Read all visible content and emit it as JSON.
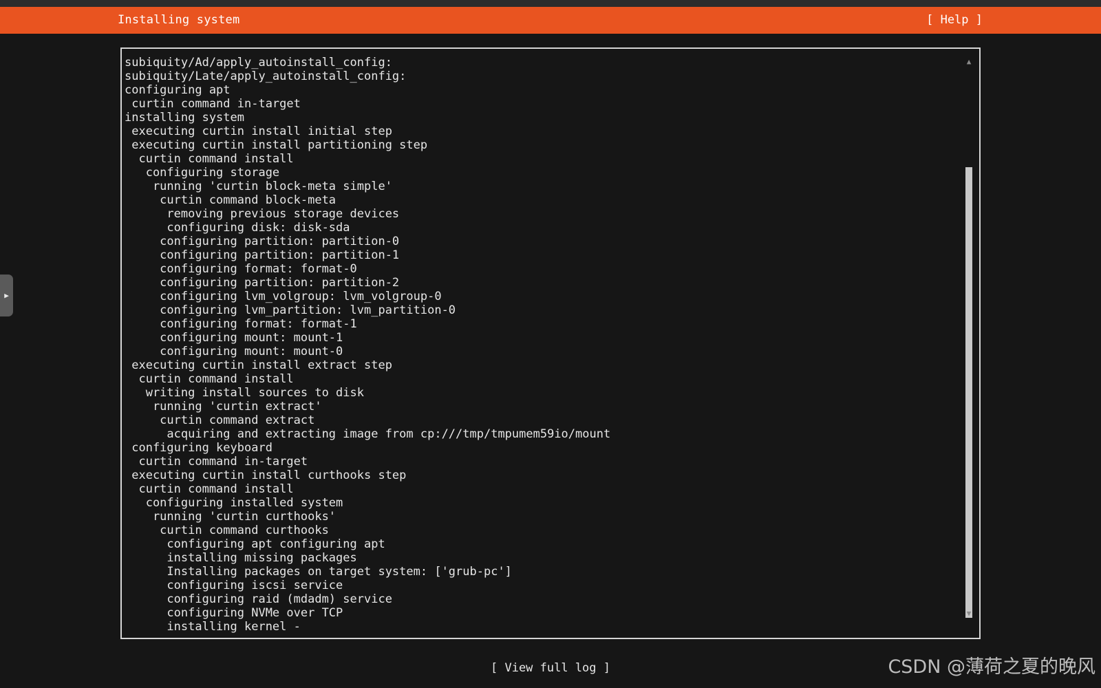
{
  "header": {
    "title": "Installing system",
    "help_label": "[ Help ]",
    "accent_color": "#e95420"
  },
  "log": {
    "lines": [
      "subiquity/Ad/apply_autoinstall_config:",
      "subiquity/Late/apply_autoinstall_config:",
      "configuring apt",
      " curtin command in-target",
      "installing system",
      " executing curtin install initial step",
      " executing curtin install partitioning step",
      "  curtin command install",
      "   configuring storage",
      "    running 'curtin block-meta simple'",
      "     curtin command block-meta",
      "      removing previous storage devices",
      "      configuring disk: disk-sda",
      "     configuring partition: partition-0",
      "     configuring partition: partition-1",
      "     configuring format: format-0",
      "     configuring partition: partition-2",
      "     configuring lvm_volgroup: lvm_volgroup-0",
      "     configuring lvm_partition: lvm_partition-0",
      "     configuring format: format-1",
      "     configuring mount: mount-1",
      "     configuring mount: mount-0",
      " executing curtin install extract step",
      "  curtin command install",
      "   writing install sources to disk",
      "    running 'curtin extract'",
      "     curtin command extract",
      "      acquiring and extracting image from cp:///tmp/tmpumem59io/mount",
      " configuring keyboard",
      "  curtin command in-target",
      " executing curtin install curthooks step",
      "  curtin command install",
      "   configuring installed system",
      "    running 'curtin curthooks'",
      "     curtin command curthooks",
      "      configuring apt configuring apt",
      "      installing missing packages",
      "      Installing packages on target system: ['grub-pc']",
      "      configuring iscsi service",
      "      configuring raid (mdadm) service",
      "      configuring NVMe over TCP",
      "      installing kernel -"
    ]
  },
  "scrollbar": {
    "up_icon": "▲",
    "down_icon": "▼"
  },
  "side_tab": {
    "icon": "▶"
  },
  "footer": {
    "view_log_label": "[ View full log ]"
  },
  "watermark": {
    "text": "CSDN @薄荷之夏的晚风"
  }
}
